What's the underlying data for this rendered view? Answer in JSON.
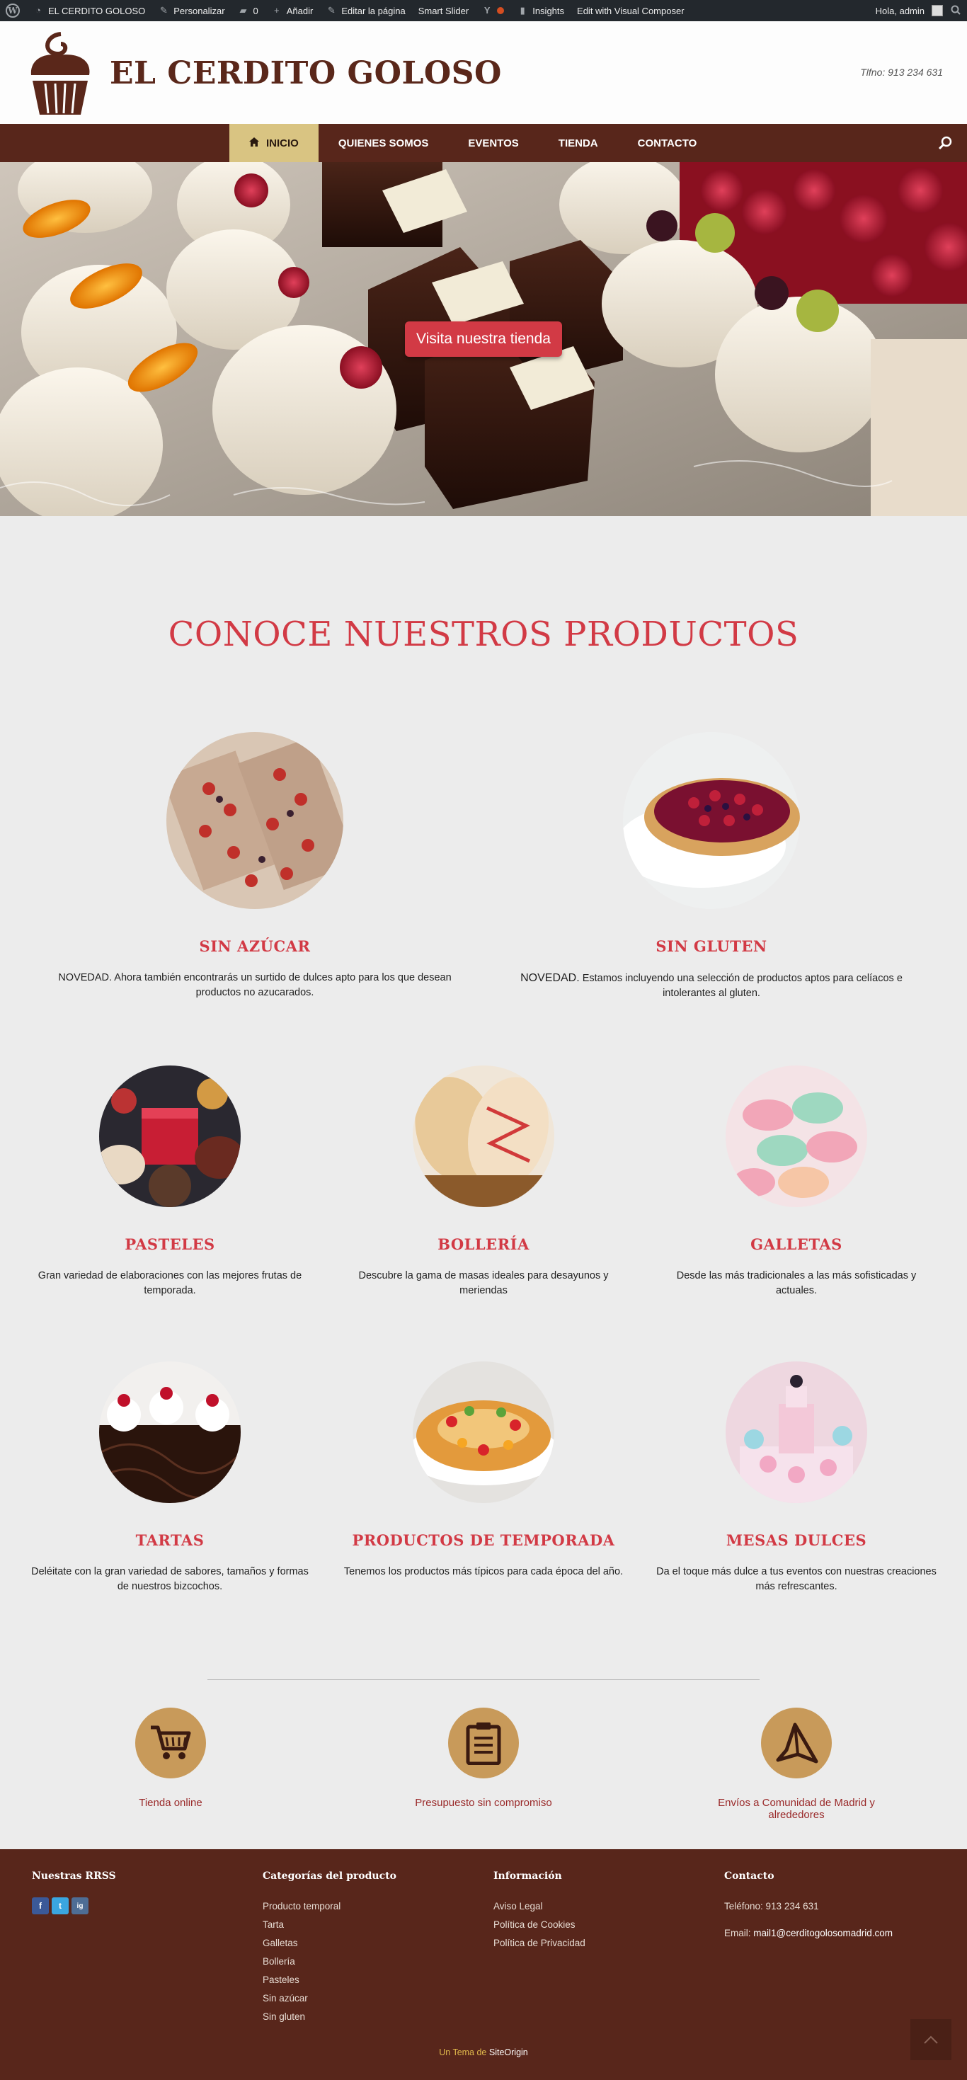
{
  "adminbar": {
    "site_name": "EL CERDITO GOLOSO",
    "customize": "Personalizar",
    "comments_count": "0",
    "add_new": "Añadir",
    "edit_page": "Editar la página",
    "smart_slider": "Smart Slider",
    "insights": "Insights",
    "edit_vc": "Edit with Visual Composer",
    "greeting": "Hola, admin"
  },
  "header": {
    "title": "EL CERDITO GOLOSO",
    "phone": "Tlfno: 913 234 631"
  },
  "nav": {
    "items": [
      {
        "label": "INICIO",
        "icon": "home-icon"
      },
      {
        "label": "QUIENES SOMOS"
      },
      {
        "label": "EVENTOS"
      },
      {
        "label": "TIENDA"
      },
      {
        "label": "CONTACTO"
      }
    ]
  },
  "hero": {
    "button": "Visita nuestra tienda"
  },
  "section": {
    "title": "CONOCE NUESTROS PRODUCTOS"
  },
  "products": [
    {
      "title": "SIN AZÚCAR",
      "text": "NOVEDAD. Ahora también encontrarás un surtido de dulces apto para los que desean productos no azucarados."
    },
    {
      "title": "SIN GLUTEN",
      "lead": "NOVEDAD.",
      "text": " Estamos incluyendo una selección de productos aptos para celíacos e intolerantes al gluten."
    },
    {
      "title": "PASTELES",
      "text": "Gran variedad de elaboraciones con las mejores frutas de temporada."
    },
    {
      "title": "BOLLERÍA",
      "text": "Descubre la gama de masas ideales para desayunos y meriendas"
    },
    {
      "title": "GALLETAS",
      "text": "Desde las más tradicionales a las más sofisticadas y actuales."
    },
    {
      "title": "TARTAS",
      "text": "Deléitate con la gran variedad de sabores, tamaños y formas de nuestros bizcochos."
    },
    {
      "title": "PRODUCTOS DE TEMPORADA",
      "text": "Tenemos los productos más típicos para cada época del año."
    },
    {
      "title": "MESAS DULCES",
      "text": "Da el toque más dulce a tus eventos con nuestras creaciones más refrescantes."
    }
  ],
  "features": [
    {
      "label": "Tienda online",
      "icon": "shopping-cart-icon"
    },
    {
      "label": "Presupuesto sin compromiso",
      "icon": "clipboard-icon"
    },
    {
      "label": "Envíos a Comunidad de Madrid y alrededores",
      "icon": "paper-plane-icon"
    }
  ],
  "footer": {
    "rrss_title": "Nuestras RRSS",
    "social": [
      "f",
      "t",
      "ig"
    ],
    "categories_title": "Categorías del producto",
    "categories": [
      "Producto temporal",
      "Tarta",
      "Galletas",
      "Bollería",
      "Pasteles",
      "Sin azúcar",
      "Sin gluten"
    ],
    "info_title": "Información",
    "info": [
      "Aviso Legal",
      "Política de Cookies",
      "Política de Privacidad"
    ],
    "contact_title": "Contacto",
    "phone": "Teléfono: 913 234 631",
    "email_label": "Email: ",
    "email": "mail1@cerditogolosomadrid.com",
    "credit_pre": "Un Tema de ",
    "credit_name": "SiteOrigin"
  },
  "colors": {
    "brown": "#58261b",
    "accent_red": "#d23a45",
    "gold": "#d9c482",
    "feature_circle": "#c89a5a"
  }
}
